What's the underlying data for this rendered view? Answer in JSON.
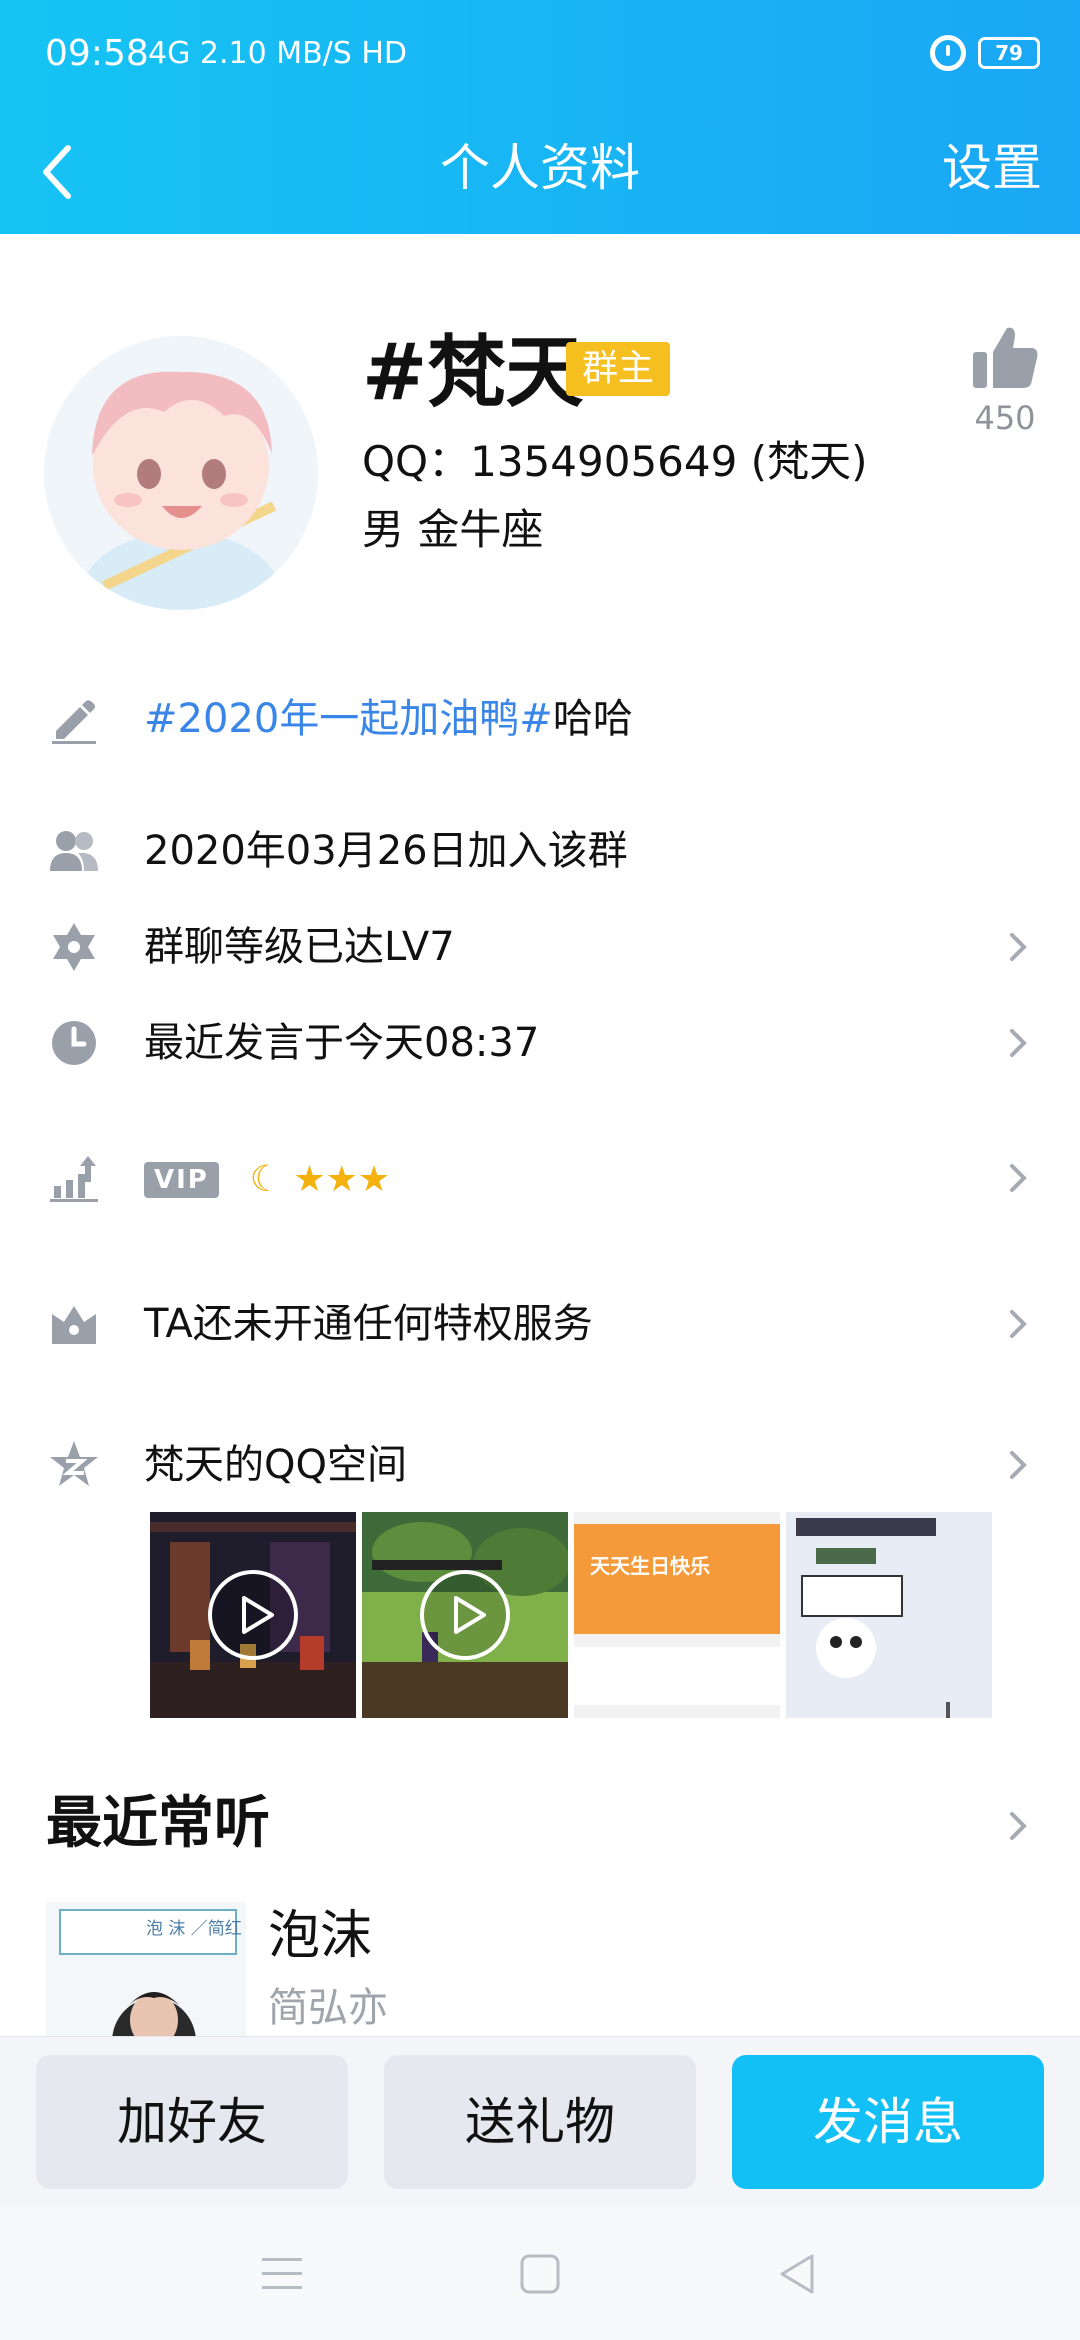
{
  "status_bar": {
    "time": "09:58",
    "network": "4G 2.10 MB/S HD",
    "battery": "79"
  },
  "nav": {
    "title": "个人资料",
    "settings": "设置"
  },
  "profile": {
    "nickname": "#梵天",
    "badge": "群主",
    "likes": "450",
    "qq_line": "QQ：1354905649 (梵天)",
    "gender_line": "男  金牛座"
  },
  "rows": {
    "signature_tag": "#2020年一起加油鸭#",
    "signature_rest": "哈哈",
    "join_date": "2020年03月26日加入该群",
    "group_level": "群聊等级已达LV7",
    "last_speak": "最近发言于今天08:37",
    "vip_label": "VIP",
    "privilege": "TA还未开通任何特权服务",
    "qzone": "梵天的QQ空间"
  },
  "level_icons": {
    "moon": "☾",
    "stars": "★★★"
  },
  "qzone_thumbs": {
    "third_caption": "天天生日快乐"
  },
  "music": {
    "section_title": "最近常听",
    "song_title": "泡沫",
    "artist": "简弘亦",
    "cover_text": "泡  沫 ／简红"
  },
  "actions": {
    "add_friend": "加好友",
    "send_gift": "送礼物",
    "send_message": "发消息"
  },
  "colors": {
    "header_gradient_start": "#16c4f3",
    "header_gradient_end": "#1aa7f5",
    "badge_yellow": "#f5bf1f",
    "link_blue": "#3a86e8",
    "primary_button": "#13c0f5"
  }
}
